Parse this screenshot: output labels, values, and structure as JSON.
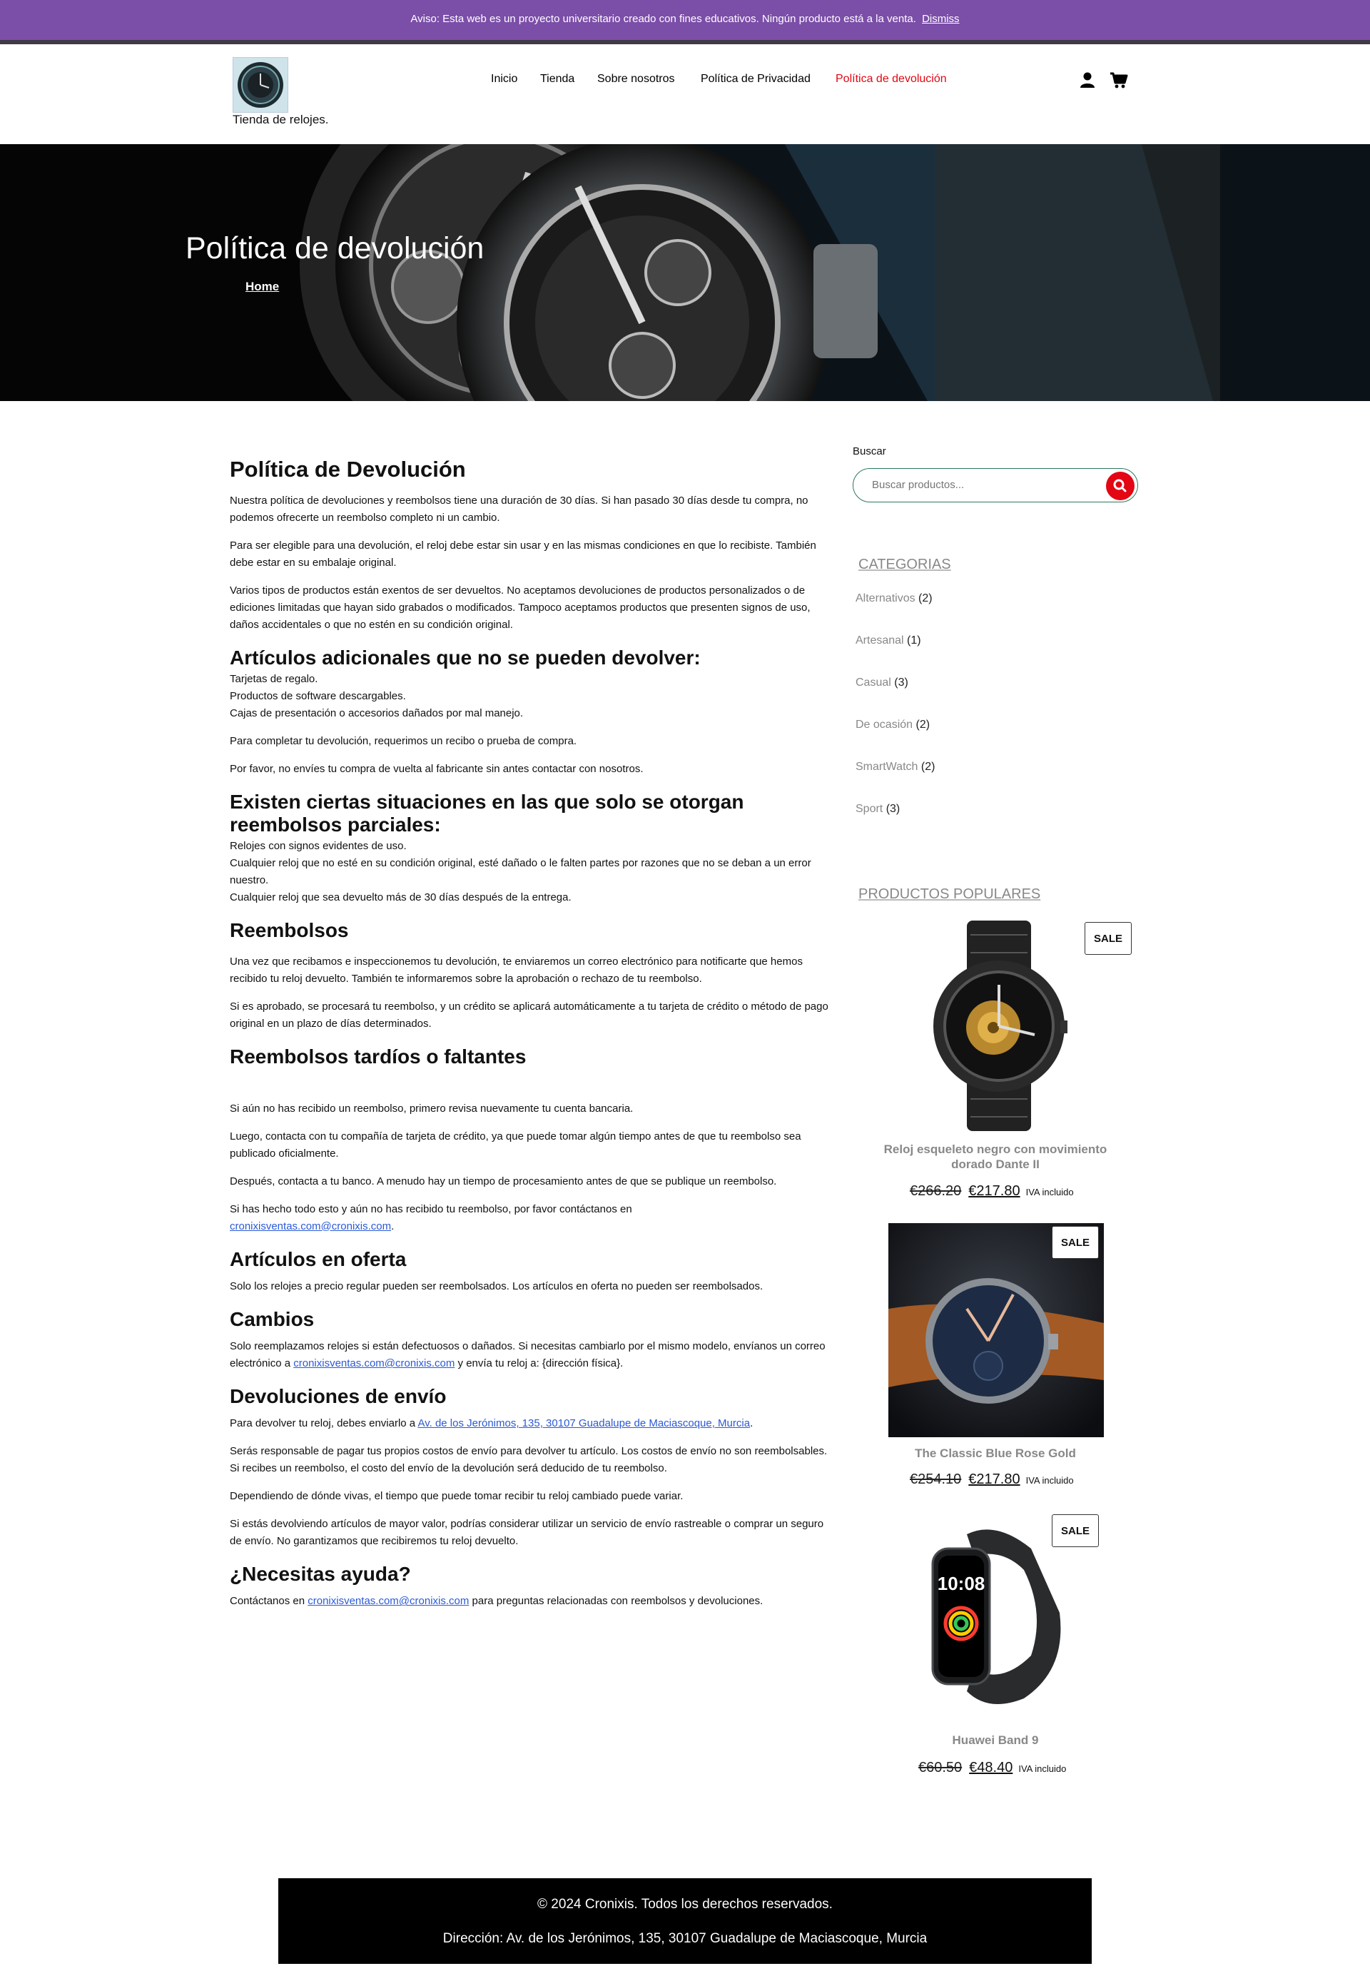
{
  "notice": {
    "text": "Aviso: Esta web es un proyecto universitario creado con fines educativos. Ningún producto está a la venta.",
    "dismiss": "Dismiss"
  },
  "header": {
    "logo_text": "Tienda de relojes.",
    "nav": [
      "Inicio",
      "Tienda",
      "Sobre nosotros",
      "Política de Privacidad",
      "Política de devolución"
    ],
    "active_nav": "Política de devolución",
    "icons": [
      "user-icon",
      "cart-icon"
    ]
  },
  "hero": {
    "title": "Política de devolución",
    "breadcrumb_home": "Home"
  },
  "article": {
    "h_main": "Política de Devolución",
    "p1": "Nuestra política de devoluciones y reembolsos tiene una duración de 30 días. Si han pasado 30 días desde tu compra, no podemos ofrecerte un reembolso completo ni un cambio.",
    "p2": "Para ser elegible para una devolución, el reloj debe estar sin usar y en las mismas condiciones en que lo recibiste. También debe estar en su embalaje original.",
    "p3": "Varios tipos de productos están exentos de ser devueltos. No aceptamos devoluciones de productos personalizados o de ediciones limitadas que hayan sido grabados o modificados. Tampoco aceptamos productos que presenten signos de uso, daños accidentales o que no estén en su condición original.",
    "h_adicionales": "Artículos adicionales que no se pueden devolver:",
    "adicionales": [
      "Tarjetas de regalo.",
      "Productos de software descargables.",
      "Cajas de presentación o accesorios dañados por mal manejo."
    ],
    "p_recibo": "Para completar tu devolución, requerimos un recibo o prueba de compra.",
    "p_fabricante": "Por favor, no envíes tu compra de vuelta al fabricante sin antes contactar con nosotros.",
    "h_parciales": "Existen ciertas situaciones en las que solo se otorgan reembolsos parciales:",
    "parciales": [
      "Relojes con signos evidentes de uso.",
      "Cualquier reloj que no esté en su condición original, esté dañado o le falten partes por razones que no se deban a un error nuestro.",
      "Cualquier reloj que sea devuelto más de 30 días después de la entrega."
    ],
    "h_reembolsos": "Reembolsos",
    "r1": "Una vez que recibamos e inspeccionemos tu devolución, te enviaremos un correo electrónico para notificarte que hemos recibido tu reloj devuelto. También te informaremos sobre la aprobación o rechazo de tu reembolso.",
    "r2": "Si es aprobado, se procesará tu reembolso, y un crédito se aplicará automáticamente a tu tarjeta de crédito o método de pago original en un plazo de días determinados.",
    "h_tardios": "Reembolsos tardíos o faltantes",
    "t1": "Si aún no has recibido un reembolso, primero revisa nuevamente tu cuenta bancaria.",
    "t2": "Luego, contacta con tu compañía de tarjeta de crédito, ya que puede tomar algún tiempo antes de que tu reembolso sea publicado oficialmente.",
    "t3": "Después, contacta a tu banco. A menudo hay un tiempo de procesamiento antes de que se publique un reembolso.",
    "t4": "Si has hecho todo esto y aún no has recibido tu reembolso, por favor contáctanos en",
    "email": "cronixisventas.com@cronixis.com",
    "h_oferta": "Artículos en oferta",
    "o1": "Solo los relojes a precio regular pueden ser reembolsados. Los artículos en oferta no pueden ser reembolsados.",
    "h_cambios": "Cambios",
    "c1_pre": "Solo reemplazamos relojes si están defectuosos o dañados. Si necesitas cambiarlo por el mismo modelo, envíanos un correo electrónico a",
    "c1_post": "y envía tu reloj a: {dirección física}.",
    "h_envio": "Devoluciones de envío",
    "e1_pre": "Para devolver tu reloj, debes enviarlo a",
    "address_link": " Av. de los Jerónimos, 135, 30107 Guadalupe de Maciascoque, Murcia",
    "e2": "Serás responsable de pagar tus propios costos de envío para devolver tu artículo. Los costos de envío no son reembolsables. Si recibes un reembolso, el costo del envío de la devolución será deducido de tu reembolso.",
    "e3": "Dependiendo de dónde vivas, el tiempo que puede tomar recibir tu reloj cambiado puede variar.",
    "e4": "Si estás devolviendo artículos de mayor valor, podrías considerar utilizar un servicio de envío rastreable o comprar un seguro de envío. No garantizamos que recibiremos tu reloj devuelto.",
    "h_ayuda": "¿Necesitas ayuda?",
    "a1_pre": "Contáctanos en",
    "a1_post": "para preguntas relacionadas con reembolsos y devoluciones."
  },
  "sidebar": {
    "search_label": "Buscar",
    "search_placeholder": "Buscar productos...",
    "categories_heading": "CATEGORIAS",
    "categories": [
      {
        "name": "Alternativos",
        "count": "(2)"
      },
      {
        "name": "Artesanal",
        "count": "(1)"
      },
      {
        "name": "Casual",
        "count": "(3)"
      },
      {
        "name": "De ocasión",
        "count": "(2)"
      },
      {
        "name": "SmartWatch",
        "count": "(2)"
      },
      {
        "name": "Sport",
        "count": "(3)"
      }
    ],
    "popular_heading": "PRODUCTOS POPULARES",
    "sale_label": "SALE",
    "iva_label": "IVA incluido",
    "products": [
      {
        "name": "Reloj esqueleto negro con movimiento dorado Dante II",
        "old_price": "€266.20",
        "price": "€217.80"
      },
      {
        "name": "The Classic Blue Rose Gold",
        "old_price": "€254.10",
        "price": "€217.80"
      },
      {
        "name": "Huawei Band 9",
        "old_price": "€60.50",
        "price": "€48.40"
      }
    ]
  },
  "footer": {
    "copyright": "© 2024 Cronixis. Todos los derechos reservados.",
    "address": "Dirección: Av. de los Jerónimos, 135, 30107 Guadalupe de Maciascoque, Murcia"
  },
  "colors": {
    "notice_bg": "#7b4ea8",
    "active_nav": "#e30613",
    "search_button": "#e30613",
    "footer_bg": "#000000"
  }
}
